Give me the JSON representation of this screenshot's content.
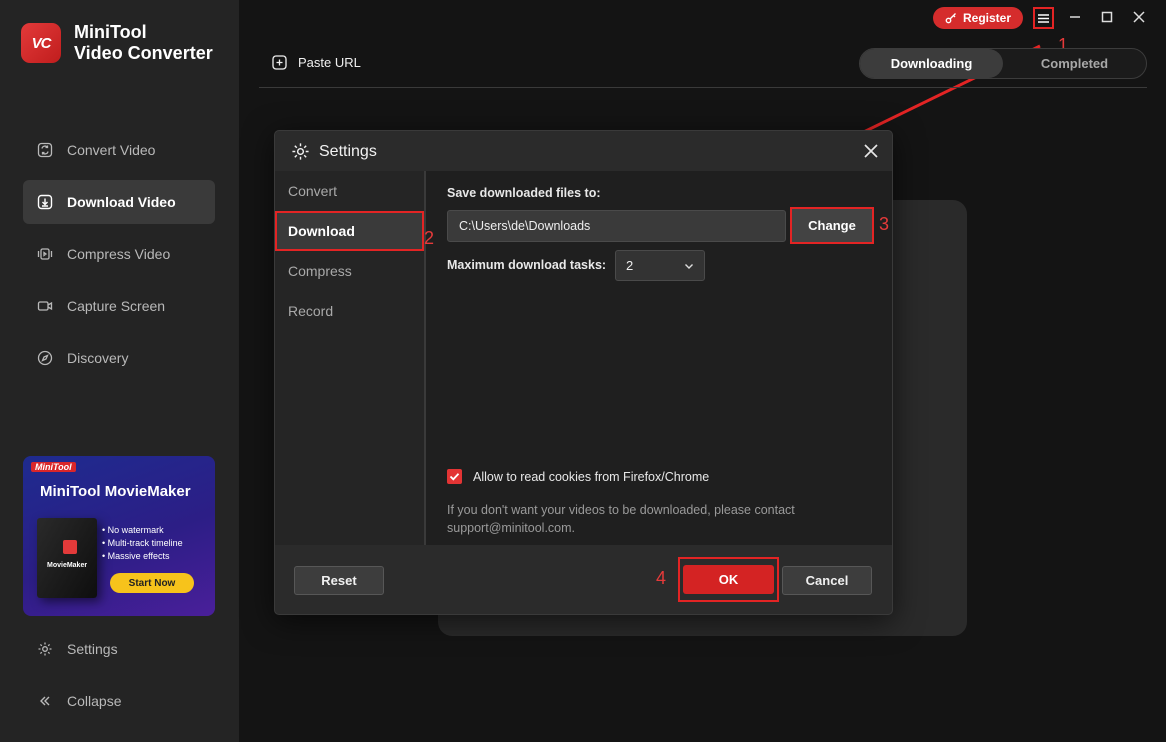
{
  "app": {
    "logo_text": "VC",
    "name_line1": "MiniTool",
    "name_line2": "Video Converter"
  },
  "sidebar": {
    "items": [
      {
        "label": "Convert Video",
        "icon": "convert-icon"
      },
      {
        "label": "Download Video",
        "icon": "download-icon"
      },
      {
        "label": "Compress Video",
        "icon": "compress-icon"
      },
      {
        "label": "Capture Screen",
        "icon": "camera-icon"
      },
      {
        "label": "Discovery",
        "icon": "compass-icon"
      }
    ],
    "bottom": [
      {
        "label": "Settings",
        "icon": "gear-icon"
      },
      {
        "label": "Collapse",
        "icon": "chevrons-left-icon"
      }
    ]
  },
  "promo": {
    "brand": "MiniTool",
    "title": "MiniTool MovieMaker",
    "box_label": "MovieMaker",
    "features": [
      "No watermark",
      "Multi-track timeline",
      "Massive effects"
    ],
    "cta": "Start Now"
  },
  "topbar": {
    "register": "Register"
  },
  "annotations": {
    "a1": "1",
    "a2": "2",
    "a3": "3",
    "a4": "4"
  },
  "main": {
    "paste_url": "Paste URL",
    "tabs": [
      {
        "label": "Downloading",
        "active": true
      },
      {
        "label": "Completed",
        "active": false
      }
    ]
  },
  "dialog": {
    "title": "Settings",
    "tabs": [
      {
        "label": "Convert",
        "active": false
      },
      {
        "label": "Download",
        "active": true
      },
      {
        "label": "Compress",
        "active": false
      },
      {
        "label": "Record",
        "active": false
      }
    ],
    "save_label": "Save downloaded files to:",
    "save_path": "C:\\Users\\de\\Downloads",
    "change": "Change",
    "max_tasks_label": "Maximum download tasks:",
    "max_tasks_value": "2",
    "cookies_label": "Allow to read cookies from Firefox/Chrome",
    "cookies_checked": true,
    "note_line1": "If you don't want your videos to be downloaded, please contact",
    "note_line2": "support@minitool.com.",
    "reset": "Reset",
    "ok": "OK",
    "cancel": "Cancel"
  },
  "colors": {
    "accent": "#e32424",
    "bg": "#141414",
    "sidebar": "#242424"
  }
}
